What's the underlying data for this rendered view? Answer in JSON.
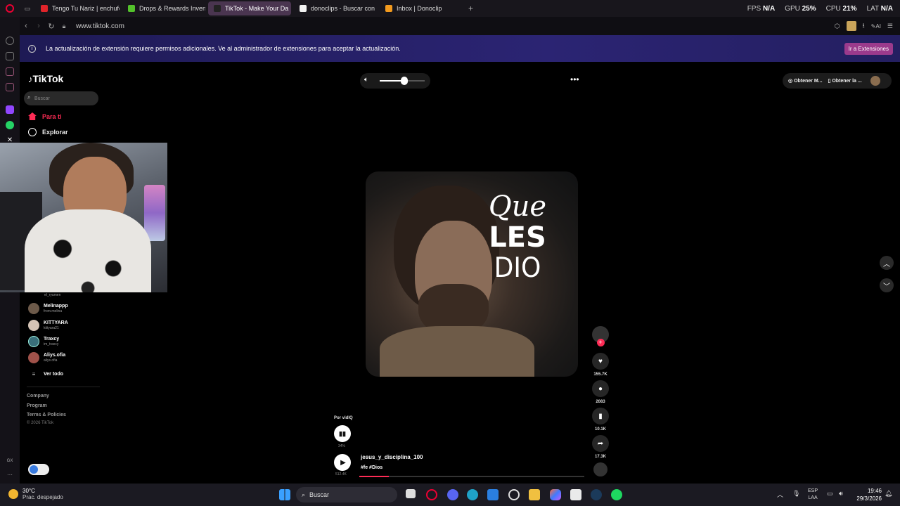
{
  "browser": {
    "tabs": [
      {
        "label": "Tengo Tu Nariz | enchufet",
        "color": "#e0242a"
      },
      {
        "label": "Drops & Rewards Invento",
        "color": "#53c12b"
      },
      {
        "label": "TikTok - Make Your Da",
        "color": "#222222",
        "active": true
      },
      {
        "label": "donoclips - Buscar con G",
        "color": "#f1f1f1"
      },
      {
        "label": "Inbox | Donoclip",
        "color": "#f29a1e"
      }
    ],
    "new_tab": "+",
    "url": "www.tiktok.com"
  },
  "stats": {
    "fps_label": "FPS",
    "fps_value": "N/A",
    "gpu_label": "GPU",
    "gpu_value": "25%",
    "cpu_label": "CPU",
    "cpu_value": "21%",
    "lat_label": "LAT",
    "lat_value": "N/A"
  },
  "notification": {
    "text": "La actualización de extensión requiere permisos adicionales. Ve al administrador de extensiones para aceptar la actualización.",
    "button": "Ir a Extensiones"
  },
  "tiktok": {
    "logo": "TikTok",
    "search_placeholder": "Buscar",
    "nav": [
      {
        "label": "Para ti",
        "color": "#fe2c55"
      },
      {
        "label": "Explorar",
        "color": "#ffffff"
      }
    ],
    "following": [
      {
        "name": "Melinappp",
        "handle": "from.melina"
      },
      {
        "name": "KITTYARA",
        "handle": "kittyara21"
      },
      {
        "name": "Traxcy",
        "handle": "im_traxcy"
      },
      {
        "name": "Aliys.ofia",
        "handle": "aliys.ofia"
      }
    ],
    "partial_handle": "el_ryumen",
    "see_all": "Ver todo",
    "footer": [
      "Company",
      "Program",
      "Terms & Policies"
    ],
    "copyright": "© 2026 TikTok",
    "top_right": [
      "Obtener M...",
      "Obtener la ..."
    ],
    "volume_level": 0.55
  },
  "video": {
    "overlay_lines": [
      "Que",
      "LES",
      "DIO"
    ],
    "likes": "155.7K",
    "comments": "2083",
    "saves": "10.1K",
    "shares": "17.3K",
    "author": "jesus_y_disciplina_100",
    "tags": "#fe #Dios",
    "por_label": "Por vidIQ",
    "vidiq_percent": "34%",
    "views": "512.4K",
    "progress": 0.13
  },
  "taskbar": {
    "weather_temp": "30°C",
    "weather_desc": "Prac. despejado",
    "search": "Buscar",
    "lang1": "ESP",
    "lang2": "LAA",
    "time": "19:46",
    "date": "29/3/2026"
  }
}
